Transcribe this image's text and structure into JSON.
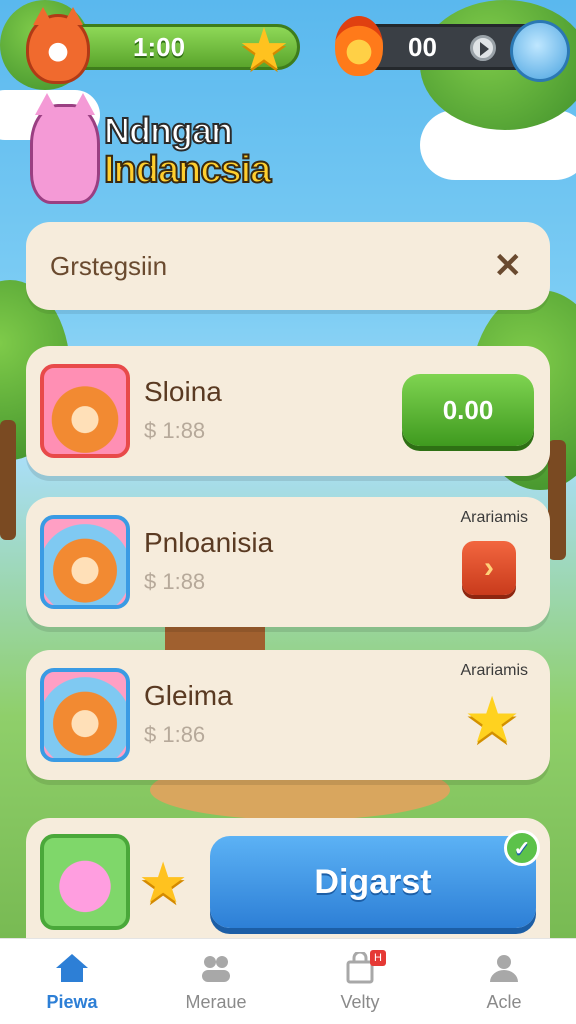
{
  "hud": {
    "timer": "1:00",
    "score": "00",
    "icons": [
      "fox-avatar",
      "star-icon",
      "flame-icon",
      "pause-icon",
      "bird-icon"
    ]
  },
  "logo": {
    "line1": "Ndngan",
    "line2": "Indancsia"
  },
  "search": {
    "label": "Grstegsiin",
    "close_icon": "✕"
  },
  "items": [
    {
      "title": "Sloina",
      "price": "$ 1:88",
      "tag": "",
      "action": "0.00",
      "action_type": "green-button"
    },
    {
      "title": "Pnloanisia",
      "price": "$ 1:88",
      "tag": "Arariamis",
      "action": "›",
      "action_type": "arrow-button"
    },
    {
      "title": "Gleima",
      "price": "$ 1:86",
      "tag": "Arariamis",
      "action": "★",
      "action_type": "star-reward"
    }
  ],
  "play": {
    "label": "Digarst",
    "check": "✓"
  },
  "nav": [
    {
      "label": "Piеwa",
      "icon": "home-icon",
      "active": true
    },
    {
      "label": "Meraue",
      "icon": "group-icon",
      "active": false
    },
    {
      "label": "Velty",
      "icon": "bag-icon",
      "active": false,
      "badge": "H"
    },
    {
      "label": "Acle",
      "icon": "user-icon",
      "active": false
    }
  ],
  "colors": {
    "accent_blue": "#2d7fd6",
    "accent_green": "#5aa52c",
    "card_bg": "#f6ecdc",
    "text_brown": "#5a3a22"
  }
}
